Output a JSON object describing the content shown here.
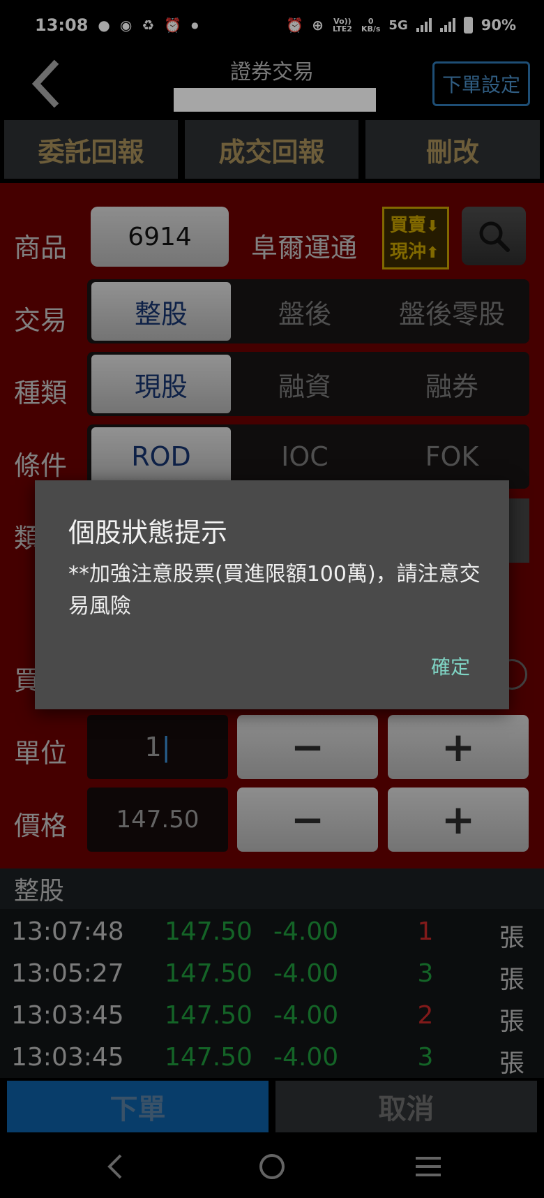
{
  "status_bar": {
    "time": "13:08",
    "network_speed_value": "0",
    "network_speed_unit": "KB/s",
    "volte": "Vo)) LTE2",
    "network_type": "5G",
    "battery": "90%"
  },
  "header": {
    "title": "證券交易",
    "order_setting_label": "下單設定"
  },
  "tabs": [
    {
      "label": "委託回報"
    },
    {
      "label": "成交回報"
    },
    {
      "label": "刪改"
    }
  ],
  "form": {
    "product_label": "商品",
    "product_code": "6914",
    "product_name": "阜爾運通",
    "daytrade_badge": {
      "line1": "買賣",
      "line2": "現沖"
    },
    "trade_label": "交易",
    "trade_options": [
      "整股",
      "盤後",
      "盤後零股"
    ],
    "type_label": "種類",
    "type_options": [
      "現股",
      "融資",
      "融券"
    ],
    "condition_label": "條件",
    "condition_options": [
      "ROD",
      "IOC",
      "FOK"
    ],
    "hidden_label_1": "類",
    "hidden_label_2": "買",
    "unit_label": "單位",
    "unit_value": "1",
    "price_label": "價格",
    "price_value": "147.50",
    "minus_symbol": "−",
    "plus_symbol": "+"
  },
  "trades": {
    "heading": "整股",
    "rows": [
      {
        "time": "13:07:48",
        "price": "147.50",
        "change": "-4.00",
        "qty": "1",
        "qty_color": "#c62828",
        "unit": "張"
      },
      {
        "time": "13:05:27",
        "price": "147.50",
        "change": "-4.00",
        "qty": "3",
        "qty_color": "#1f9a3c",
        "unit": "張"
      },
      {
        "time": "13:03:45",
        "price": "147.50",
        "change": "-4.00",
        "qty": "2",
        "qty_color": "#c62828",
        "unit": "張"
      },
      {
        "time": "13:03:45",
        "price": "147.50",
        "change": "-4.00",
        "qty": "3",
        "qty_color": "#1f9a3c",
        "unit": "張"
      }
    ]
  },
  "actions": {
    "order_label": "下單",
    "cancel_label": "取消"
  },
  "dialog": {
    "title": "個股狀態提示",
    "message": "**加強注意股票(買進限額100萬)，請注意交易風險",
    "ok_label": "確定"
  }
}
